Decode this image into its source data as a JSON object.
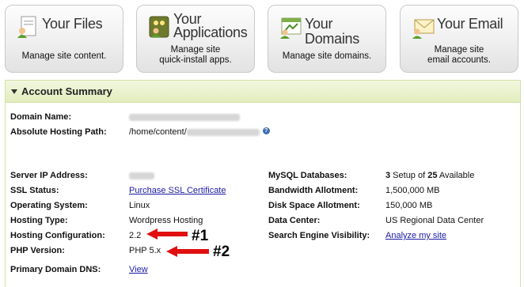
{
  "tiles": [
    {
      "title": "Your Files",
      "desc": "Manage site content."
    },
    {
      "title_line1": "Your",
      "title_line2": "Applications",
      "desc_line1": "Manage site",
      "desc_line2": "quick-install apps."
    },
    {
      "title": "Your Domains",
      "desc": "Manage site domains."
    },
    {
      "title": "Your Email",
      "desc_line1": "Manage site",
      "desc_line2": "email accounts."
    }
  ],
  "panel": {
    "title": "Account Summary",
    "labels": {
      "domain_name": "Domain Name:",
      "hosting_path": "Absolute Hosting Path:",
      "server_ip": "Server IP Address:",
      "ssl_status": "SSL Status:",
      "os": "Operating System:",
      "hosting_type": "Hosting Type:",
      "hosting_config": "Hosting Configuration:",
      "php_version": "PHP Version:",
      "primary_dns": "Primary Domain DNS:",
      "mysql": "MySQL Databases:",
      "bandwidth": "Bandwidth Allotment:",
      "disk_space": "Disk Space Allotment:",
      "data_center": "Data Center:",
      "seo_visibility": "Search Engine Visibility:"
    },
    "values": {
      "hosting_path_prefix": "/home/content/",
      "ssl_link": "Purchase SSL Certificate",
      "os": "Linux",
      "hosting_type": "Wordpress Hosting",
      "hosting_config": "2.2",
      "php_version": "PHP 5.x",
      "dns_link": "View",
      "mysql_count": "3",
      "mysql_mid": " Setup of ",
      "mysql_total": "25",
      "mysql_suffix": " Available",
      "bandwidth": "1,500,000 MB",
      "disk_space": "150,000 MB",
      "data_center": "US Regional Data Center",
      "seo_link": "Analyze my site"
    },
    "annotations": {
      "first": "#1",
      "second": "#2"
    }
  }
}
